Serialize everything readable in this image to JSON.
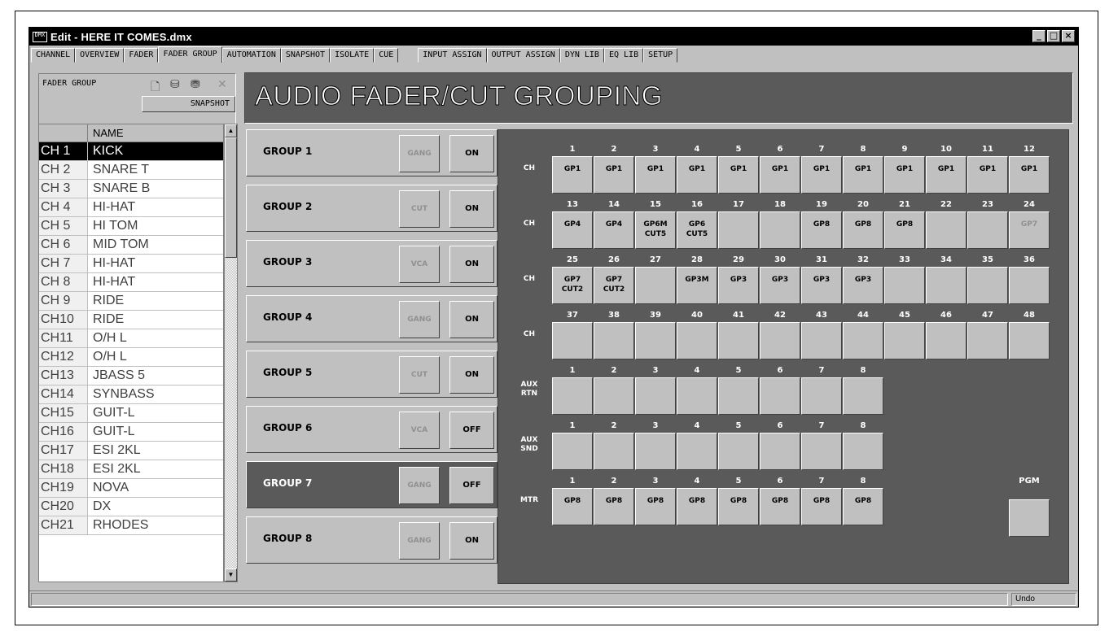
{
  "window": {
    "icon_text": "DMX",
    "title": "Edit - HERE IT COMES.dmx",
    "buttons": [
      "_",
      "□",
      "×"
    ]
  },
  "tabs": [
    {
      "label": "CHANNEL",
      "active": false
    },
    {
      "label": "OVERVIEW",
      "active": false
    },
    {
      "label": "FADER",
      "active": false
    },
    {
      "label": "FADER GROUP",
      "active": true
    },
    {
      "label": "AUTOMATION",
      "active": false
    },
    {
      "label": "SNAPSHOT",
      "active": false
    },
    {
      "label": "ISOLATE",
      "active": false
    },
    {
      "label": "CUE",
      "active": false
    },
    {
      "label": "INPUT ASSIGN",
      "active": false
    },
    {
      "label": "OUTPUT ASSIGN",
      "active": false
    },
    {
      "label": "DYN LIB",
      "active": false
    },
    {
      "label": "EQ LIB",
      "active": false
    },
    {
      "label": "SETUP",
      "active": false
    }
  ],
  "left_panel": {
    "label": "FADER GROUP",
    "snapshot_button": "SNAPSHOT",
    "icons": [
      "new-file-icon",
      "load-icon",
      "save-icon",
      "delete-icon"
    ]
  },
  "channel_list": {
    "header_name": "NAME",
    "rows": [
      {
        "ch": "CH 1",
        "name": "KICK",
        "selected": true
      },
      {
        "ch": "CH 2",
        "name": "SNARE T"
      },
      {
        "ch": "CH 3",
        "name": "SNARE B"
      },
      {
        "ch": "CH 4",
        "name": "HI-HAT"
      },
      {
        "ch": "CH 5",
        "name": "HI TOM"
      },
      {
        "ch": "CH 6",
        "name": "MID TOM"
      },
      {
        "ch": "CH 7",
        "name": "HI-HAT"
      },
      {
        "ch": "CH 8",
        "name": "HI-HAT"
      },
      {
        "ch": "CH 9",
        "name": "RIDE"
      },
      {
        "ch": "CH10",
        "name": "RIDE"
      },
      {
        "ch": "CH11",
        "name": "O/H L"
      },
      {
        "ch": "CH12",
        "name": "O/H L"
      },
      {
        "ch": "CH13",
        "name": "JBASS 5"
      },
      {
        "ch": "CH14",
        "name": "SYNBASS"
      },
      {
        "ch": "CH15",
        "name": "GUIT-L"
      },
      {
        "ch": "CH16",
        "name": "GUIT-L"
      },
      {
        "ch": "CH17",
        "name": "ESI 2KL"
      },
      {
        "ch": "CH18",
        "name": "ESI 2KL"
      },
      {
        "ch": "CH19",
        "name": "NOVA"
      },
      {
        "ch": "CH20",
        "name": "DX"
      },
      {
        "ch": "CH21",
        "name": "RHODES"
      }
    ]
  },
  "banner": {
    "title": "AUDIO FADER/CUT GROUPING"
  },
  "groups": [
    {
      "label": "GROUP 1",
      "mode": "GANG",
      "state": "ON",
      "selected": false
    },
    {
      "label": "GROUP 2",
      "mode": "CUT",
      "state": "ON",
      "selected": false
    },
    {
      "label": "GROUP 3",
      "mode": "VCA",
      "state": "ON",
      "selected": false
    },
    {
      "label": "GROUP 4",
      "mode": "GANG",
      "state": "ON",
      "selected": false
    },
    {
      "label": "GROUP 5",
      "mode": "CUT",
      "state": "ON",
      "selected": false
    },
    {
      "label": "GROUP 6",
      "mode": "VCA",
      "state": "OFF",
      "selected": false
    },
    {
      "label": "GROUP 7",
      "mode": "GANG",
      "state": "OFF",
      "selected": true
    },
    {
      "label": "GROUP 8",
      "mode": "GANG",
      "state": "ON",
      "selected": false
    }
  ],
  "grid_rows": [
    {
      "label": "CH",
      "numbers": [
        "1",
        "2",
        "3",
        "4",
        "5",
        "6",
        "7",
        "8",
        "9",
        "10",
        "11",
        "12"
      ],
      "cells": [
        "GP1",
        "GP1",
        "GP1",
        "GP1",
        "GP1",
        "GP1",
        "GP1",
        "GP1",
        "GP1",
        "GP1",
        "GP1",
        "GP1"
      ]
    },
    {
      "label": "CH",
      "numbers": [
        "13",
        "14",
        "15",
        "16",
        "17",
        "18",
        "19",
        "20",
        "21",
        "22",
        "23",
        "24"
      ],
      "cells": [
        "GP4",
        "GP4",
        "GP6M\nCUT5",
        "GP6\nCUT5",
        "",
        "",
        "GP8",
        "GP8",
        "GP8",
        "",
        "",
        "GP7"
      ]
    },
    {
      "label": "CH",
      "numbers": [
        "25",
        "26",
        "27",
        "28",
        "29",
        "30",
        "31",
        "32",
        "33",
        "34",
        "35",
        "36"
      ],
      "cells": [
        "GP7\nCUT2",
        "GP7\nCUT2",
        "",
        "GP3M",
        "GP3",
        "GP3",
        "GP3",
        "GP3",
        "",
        "",
        "",
        ""
      ]
    },
    {
      "label": "CH",
      "numbers": [
        "37",
        "38",
        "39",
        "40",
        "41",
        "42",
        "43",
        "44",
        "45",
        "46",
        "47",
        "48"
      ],
      "cells": [
        "",
        "",
        "",
        "",
        "",
        "",
        "",
        "",
        "",
        "",
        "",
        ""
      ]
    },
    {
      "label": "AUX\nRTN",
      "numbers": [
        "1",
        "2",
        "3",
        "4",
        "5",
        "6",
        "7",
        "8"
      ],
      "cells": [
        "",
        "",
        "",
        "",
        "",
        "",
        "",
        ""
      ]
    },
    {
      "label": "AUX\nSND",
      "numbers": [
        "1",
        "2",
        "3",
        "4",
        "5",
        "6",
        "7",
        "8"
      ],
      "cells": [
        "",
        "",
        "",
        "",
        "",
        "",
        "",
        ""
      ]
    },
    {
      "label": "MTR",
      "numbers": [
        "1",
        "2",
        "3",
        "4",
        "5",
        "6",
        "7",
        "8"
      ],
      "cells": [
        "GP8",
        "GP8",
        "GP8",
        "GP8",
        "GP8",
        "GP8",
        "GP8",
        "GP8"
      ]
    }
  ],
  "pgm": {
    "label": "PGM",
    "cell": ""
  },
  "status": {
    "right": "Undo"
  }
}
